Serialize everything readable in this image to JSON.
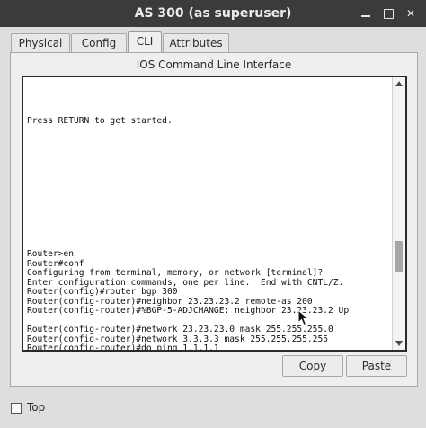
{
  "window": {
    "title": "AS 300 (as superuser)"
  },
  "tabs": [
    {
      "label": "Physical",
      "active": false
    },
    {
      "label": "Config",
      "active": false
    },
    {
      "label": "CLI",
      "active": true
    },
    {
      "label": "Attributes",
      "active": false
    }
  ],
  "panel": {
    "title": "IOS Command Line Interface"
  },
  "terminal": {
    "lines": [
      "Press RETURN to get started.",
      "Router>en",
      "Router#conf",
      "Configuring from terminal, memory, or network [terminal]?",
      "Enter configuration commands, one per line.  End with CNTL/Z.",
      "Router(config)#router bgp 300",
      "Router(config-router)#neighbor 23.23.23.2 remote-as 200",
      "Router(config-router)#%BGP-5-ADJCHANGE: neighbor 23.23.23.2 Up",
      "Router(config-router)#network 23.23.23.0 mask 255.255.255.0",
      "Router(config-router)#network 3.3.3.3 mask 255.255.255.255",
      "Router(config-router)#do ping 1.1.1.1"
    ]
  },
  "buttons": {
    "copy": "Copy",
    "paste": "Paste"
  },
  "footer": {
    "top_label": "Top",
    "top_checked": false
  },
  "icons": {
    "minimize": "minimize-icon",
    "maximize": "maximize-icon",
    "close": "close-icon",
    "scroll_up": "scroll-up-arrow-icon",
    "scroll_down": "scroll-down-arrow-icon",
    "cursor": "mouse-cursor-icon"
  }
}
